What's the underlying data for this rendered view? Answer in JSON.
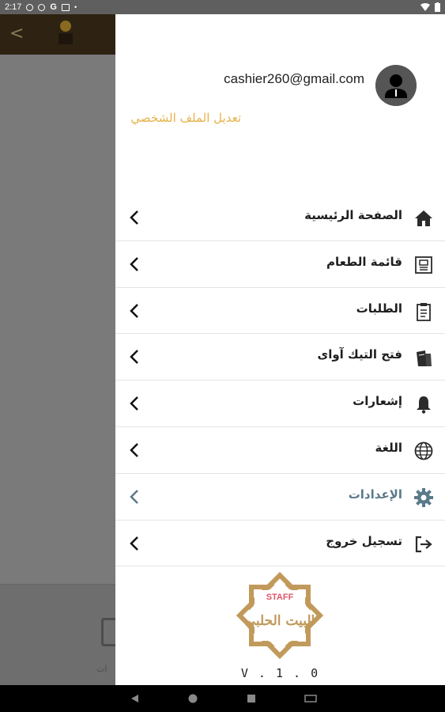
{
  "statusbar": {
    "time": "2:17",
    "left_icons": [
      "gear-icon",
      "gear-icon",
      "google-icon",
      "image-icon",
      "dot-icon"
    ],
    "right_icons": [
      "wifi-icon",
      "battery-icon"
    ]
  },
  "drawer": {
    "email": "cashier260@gmail.com",
    "edit_profile": "تعديل الملف الشخصي",
    "menu": [
      {
        "label": "الصفحة الرئيسية",
        "icon": "home-icon"
      },
      {
        "label": "قائمة الطعام",
        "icon": "menu-book-icon"
      },
      {
        "label": "الطلبات",
        "icon": "clipboard-icon"
      },
      {
        "label": "فتح التيك آواى",
        "icon": "takeaway-bag-icon"
      },
      {
        "label": "إشعارات",
        "icon": "bell-icon"
      },
      {
        "label": "اللغة",
        "icon": "globe-icon"
      },
      {
        "label": "الإعدادات",
        "icon": "gear-icon",
        "active": true
      },
      {
        "label": "تسجيل خروج",
        "icon": "logout-icon"
      }
    ],
    "logo": {
      "staff_text": "STAFF",
      "brand_text": "البيت الحلبي"
    },
    "version": "V . 1 . 0"
  },
  "colors": {
    "accent_gold": "#e6b24a",
    "logo_gold": "#c19a5b",
    "active_item": "#5a7a8a",
    "appbar_dark": "#2e2212"
  }
}
